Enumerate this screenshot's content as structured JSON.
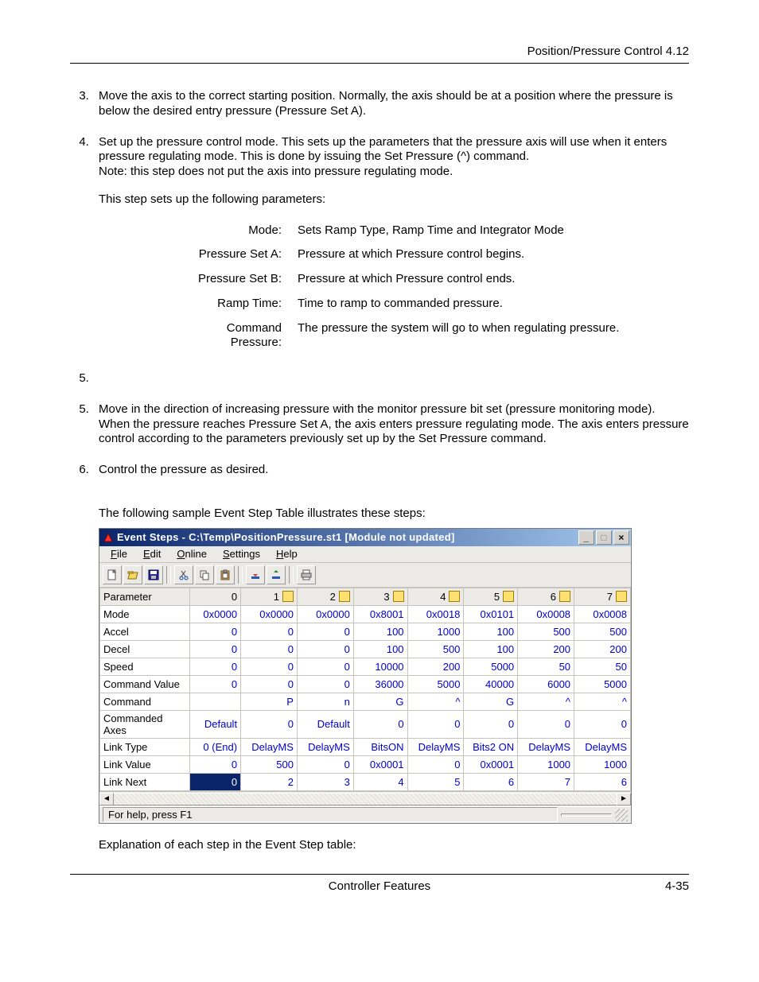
{
  "header": {
    "running_head": "Position/Pressure Control  4.12"
  },
  "body": {
    "step3": "Move the axis to the correct starting position. Normally, the axis should be at a position where the pressure is below the desired entry pressure (Pressure Set A).",
    "step4_a": "Set up the pressure control mode. This sets up the parameters that the pressure axis will use when it enters pressure regulating mode. This is done by issuing the Set Pressure (^) command.",
    "step4_note": "Note: this step does not put the axis into pressure regulating mode.",
    "step4_lead": "This step sets up the following parameters:",
    "params": [
      {
        "k": "Mode:",
        "v": "Sets Ramp Type, Ramp Time and Integrator Mode"
      },
      {
        "k": "Pressure Set A:",
        "v": "Pressure at which Pressure control begins."
      },
      {
        "k": "Pressure Set B:",
        "v": "Pressure at which Pressure control ends."
      },
      {
        "k": "Ramp Time:",
        "v": "Time to ramp to commanded pressure."
      },
      {
        "k": "Command Pressure:",
        "v": "The pressure the system will go to when regulating pressure."
      }
    ],
    "step5_empty": "",
    "step5": "Move in the direction of increasing pressure with the monitor pressure bit set (pressure monitoring mode). When the pressure reaches Pressure Set A, the axis enters pressure regulating mode. The axis enters pressure control according to the parameters previously set up by the Set Pressure command.",
    "step6": "Control the pressure as desired.",
    "intro_table": "The following sample Event Step Table illustrates these steps:",
    "explain": "Explanation of each step in the Event Step table:"
  },
  "app": {
    "title": "Event Steps - C:\\Temp\\PositionPressure.st1 [Module not updated]",
    "menus": {
      "file": "File",
      "edit": "Edit",
      "online": "Online",
      "settings": "Settings",
      "help": "Help"
    },
    "statusbar": "For help, press F1",
    "columns": [
      "Parameter",
      "0",
      "1",
      "2",
      "3",
      "4",
      "5",
      "6",
      "7"
    ],
    "rows": [
      {
        "p": "Mode",
        "v": [
          "0x0000",
          "0x0000",
          "0x0000",
          "0x8001",
          "0x0018",
          "0x0101",
          "0x0008",
          "0x0008"
        ]
      },
      {
        "p": "Accel",
        "v": [
          "0",
          "0",
          "0",
          "100",
          "1000",
          "100",
          "500",
          "500"
        ]
      },
      {
        "p": "Decel",
        "v": [
          "0",
          "0",
          "0",
          "100",
          "500",
          "100",
          "200",
          "200"
        ]
      },
      {
        "p": "Speed",
        "v": [
          "0",
          "0",
          "0",
          "10000",
          "200",
          "5000",
          "50",
          "50"
        ]
      },
      {
        "p": "Command Value",
        "v": [
          "0",
          "0",
          "0",
          "36000",
          "5000",
          "40000",
          "6000",
          "5000"
        ]
      },
      {
        "p": "Command",
        "v": [
          "",
          "P",
          "n",
          "G",
          "^",
          "G",
          "^",
          "^"
        ]
      },
      {
        "p": "Commanded Axes",
        "v": [
          "Default",
          "0",
          "Default",
          "0",
          "0",
          "0",
          "0",
          "0"
        ]
      },
      {
        "p": "Link Type",
        "v": [
          "0 (End)",
          "DelayMS",
          "DelayMS",
          "BitsON",
          "DelayMS",
          "Bits2 ON",
          "DelayMS",
          "DelayMS"
        ]
      },
      {
        "p": "Link Value",
        "v": [
          "0",
          "500",
          "0",
          "0x0001",
          "0",
          "0x0001",
          "1000",
          "1000"
        ]
      },
      {
        "p": "Link Next",
        "v": [
          "0",
          "2",
          "3",
          "4",
          "5",
          "6",
          "7",
          "6"
        ],
        "sel0": true
      }
    ]
  },
  "footer": {
    "center": "Controller Features",
    "right": "4-35"
  }
}
